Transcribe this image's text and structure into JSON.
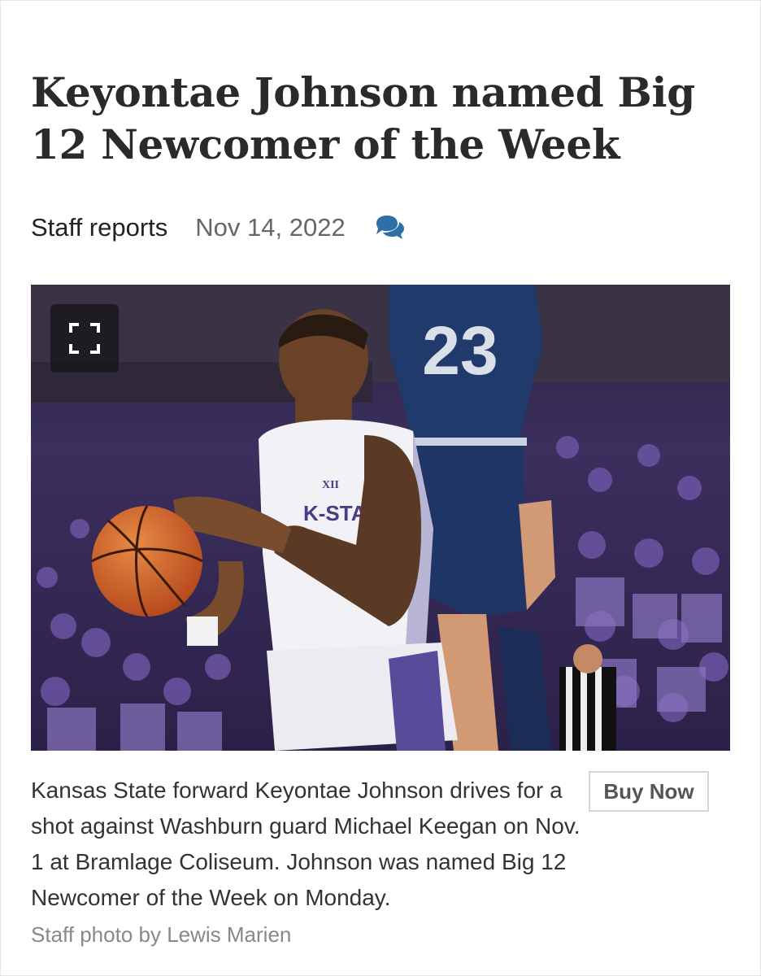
{
  "article": {
    "headline": "Keyontae Johnson named Big 12 Newcomer of the Week",
    "author": "Staff reports",
    "date": "Nov 14, 2022",
    "comments_icon": "comments-icon"
  },
  "photo": {
    "expand_icon": "expand-icon",
    "jersey_number": "23",
    "jersey_text": "K-STATE",
    "conference_mark": "XII",
    "caption": "Kansas State forward Keyontae Johnson drives for a shot against Washburn guard Michael Keegan on Nov. 1 at Bramlage Coliseum. Johnson was named Big 12 Newcomer of the Week on Monday.",
    "buy_now_label": "Buy Now",
    "credit": "Staff photo by Lewis Marien"
  },
  "colors": {
    "headline": "#2a2a2a",
    "accent_icon": "#2f6fa8",
    "crowd_purple": "#4a3a78",
    "opponent_navy": "#1f3a6b"
  }
}
